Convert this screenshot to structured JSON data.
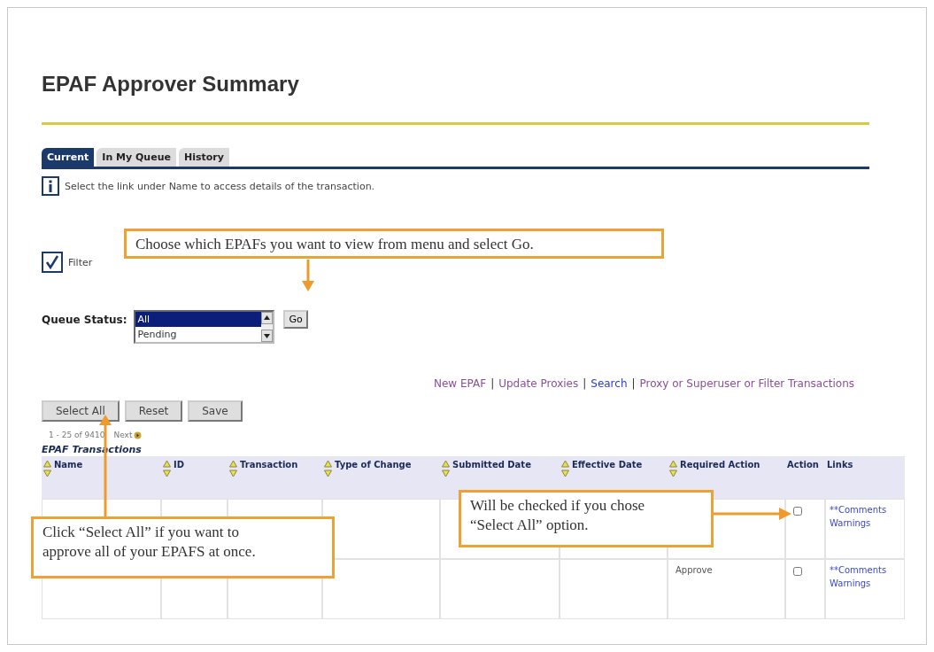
{
  "page": {
    "title": "EPAF Approver Summary"
  },
  "tabs": [
    {
      "label": "Current",
      "selected": true
    },
    {
      "label": "In My Queue",
      "selected": false
    },
    {
      "label": "History",
      "selected": false
    }
  ],
  "info_message": "Select the link under Name to access details of the transaction.",
  "filtering": {
    "label": "Filter",
    "checked": true
  },
  "queue_status": {
    "label": "Queue Status:",
    "options": [
      {
        "label": "All",
        "selected": true
      },
      {
        "label": "Pending",
        "selected": false
      }
    ],
    "button": "Go"
  },
  "links": [
    {
      "label": "New EPAF",
      "visited": true
    },
    {
      "label": "Update Proxies",
      "visited": true
    },
    {
      "label": "Search",
      "visited": false
    },
    {
      "label": "Proxy or Superuser or Filter Transactions",
      "visited": true
    }
  ],
  "link_separator": "|",
  "buttons": [
    "Select All",
    "Reset",
    "Save"
  ],
  "pagination": {
    "range": "1 - 25 of 9410",
    "next": "Next"
  },
  "table": {
    "caption": "EPAF Transactions",
    "columns": [
      {
        "label": "Name",
        "sortable": true
      },
      {
        "label": "ID",
        "sortable": true
      },
      {
        "label": "Transaction",
        "sortable": true
      },
      {
        "label": "Type of Change",
        "sortable": true
      },
      {
        "label": "Submitted Date",
        "sortable": true
      },
      {
        "label": "Effective Date",
        "sortable": true
      },
      {
        "label": "Required Action",
        "sortable": true
      },
      {
        "label": "Action",
        "sortable": false
      },
      {
        "label": "Links",
        "sortable": false
      }
    ],
    "rows": [
      {
        "checked": false,
        "links": [
          "**Comments",
          "Warnings"
        ]
      },
      {
        "required_action": "Approve",
        "checked": false,
        "links": [
          "**Comments",
          "Warnings"
        ]
      }
    ]
  },
  "callouts": [
    {
      "kind": "down",
      "text": "Choose which EPAFs you want to view from menu and select Go."
    },
    {
      "kind": "up",
      "text": "Click “Select All” if you want to approve all of your EPAFS at once."
    },
    {
      "kind": "right",
      "text": "Will be checked if you chose “Select All” option."
    }
  ]
}
